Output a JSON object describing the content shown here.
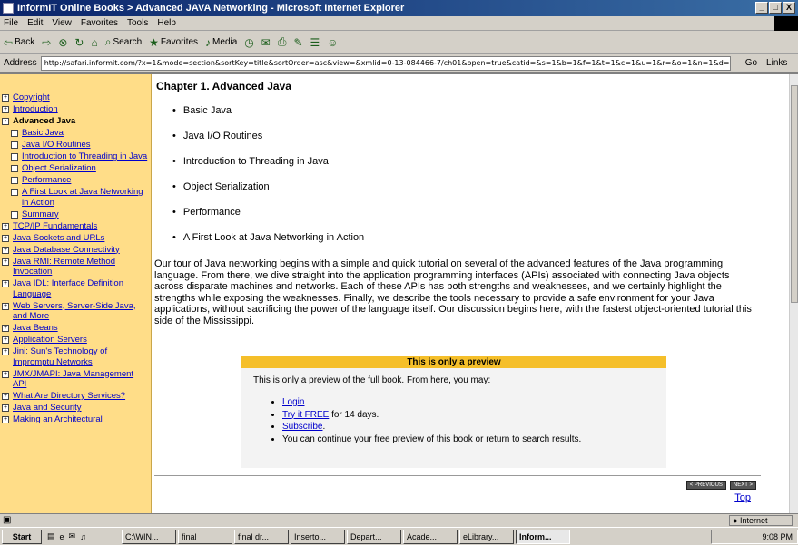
{
  "window": {
    "title": "InformIT Online Books > Advanced JAVA Networking - Microsoft Internet Explorer",
    "min": "_",
    "max": "□",
    "close": "X"
  },
  "menu": [
    "File",
    "Edit",
    "View",
    "Favorites",
    "Tools",
    "Help"
  ],
  "toolbar": {
    "back": "Back",
    "search": "Search",
    "favorites": "Favorites",
    "media": "Media"
  },
  "address": {
    "label": "Address",
    "url": "http://safari.informit.com/?x=1&mode=section&sortKey=title&sortOrder=asc&view=&xmlid=0-13-084466-7/ch01&open=true&catid=&s=1&b=1&f=1&t=1&c=1&u=1&r=&o=1&n=1&d=1&p=1&a=0",
    "go": "Go",
    "links": "Links"
  },
  "sidebar": {
    "items": [
      {
        "label": "Copyright",
        "box": "+",
        "sub": false,
        "current": false
      },
      {
        "label": "Introduction",
        "box": "+",
        "sub": false,
        "current": false
      },
      {
        "label": "Advanced Java",
        "box": "-",
        "sub": false,
        "current": true
      },
      {
        "label": "Basic Java",
        "box": "",
        "sub": true,
        "current": false
      },
      {
        "label": "Java I/O Routines",
        "box": "",
        "sub": true,
        "current": false
      },
      {
        "label": "Introduction to Threading in Java",
        "box": "",
        "sub": true,
        "current": false
      },
      {
        "label": "Object Serialization",
        "box": "",
        "sub": true,
        "current": false
      },
      {
        "label": "Performance",
        "box": "",
        "sub": true,
        "current": false
      },
      {
        "label": "A First Look at Java Networking in Action",
        "box": "",
        "sub": true,
        "current": false
      },
      {
        "label": "Summary",
        "box": "",
        "sub": true,
        "current": false
      },
      {
        "label": "TCP/IP Fundamentals",
        "box": "+",
        "sub": false,
        "current": false
      },
      {
        "label": "Java Sockets and URLs",
        "box": "+",
        "sub": false,
        "current": false
      },
      {
        "label": "Java Database Connectivity",
        "box": "+",
        "sub": false,
        "current": false
      },
      {
        "label": "Java RMI: Remote Method Invocation",
        "box": "+",
        "sub": false,
        "current": false
      },
      {
        "label": "Java IDL: Interface Definition Language",
        "box": "+",
        "sub": false,
        "current": false
      },
      {
        "label": "Web Servers, Server-Side Java, and More",
        "box": "+",
        "sub": false,
        "current": false
      },
      {
        "label": "Java Beans",
        "box": "+",
        "sub": false,
        "current": false
      },
      {
        "label": "Application Servers",
        "box": "+",
        "sub": false,
        "current": false
      },
      {
        "label": "Jini: Sun's Technology of Impromptu Networks",
        "box": "+",
        "sub": false,
        "current": false
      },
      {
        "label": "JMX/JMAPI: Java Management API",
        "box": "+",
        "sub": false,
        "current": false
      },
      {
        "label": "What Are Directory Services?",
        "box": "+",
        "sub": false,
        "current": false
      },
      {
        "label": "Java and Security",
        "box": "+",
        "sub": false,
        "current": false
      },
      {
        "label": "Making an Architectural",
        "box": "+",
        "sub": false,
        "current": false
      }
    ]
  },
  "main": {
    "title": "Chapter 1. Advanced Java",
    "bullets": [
      "Basic Java",
      "Java I/O Routines",
      "Introduction to Threading in Java",
      "Object Serialization",
      "Performance",
      "A First Look at Java Networking in Action"
    ],
    "intro": "Our tour of Java networking begins with a simple and quick tutorial on several of the advanced features of the Java programming language. From there, we dive straight into the application programming interfaces (APIs) associated with connecting Java objects across disparate machines and networks. Each of these APIs has both strengths and weaknesses, and we certainly highlight the strengths while exposing the weaknesses. Finally, we describe the tools necessary to provide a safe environment for your Java applications, without sacrificing the power of the language itself. Our discussion begins here, with the fastest object-oriented tutorial this side of the Mississippi.",
    "preview": {
      "heading": "This is only a preview",
      "text": "This is only a preview of the full book. From here, you may:",
      "login": "Login",
      "try_link": "Try it FREE",
      "try_rest": " for 14 days.",
      "subscribe": "Subscribe",
      "subscribe_rest": ".",
      "continue": "You can continue your free preview of this book or return to search results."
    },
    "prev": "< PREVIOUS",
    "next": "NEXT >",
    "top": "Top"
  },
  "status": {
    "zone": "Internet"
  },
  "taskbar": {
    "start": "Start",
    "tasks": [
      "C:\\WIN...",
      "final",
      "final dr...",
      "Inserto...",
      "Depart...",
      "Acade...",
      "eLibrary...",
      "Inform..."
    ],
    "active": 7,
    "clock": "9:08 PM"
  }
}
